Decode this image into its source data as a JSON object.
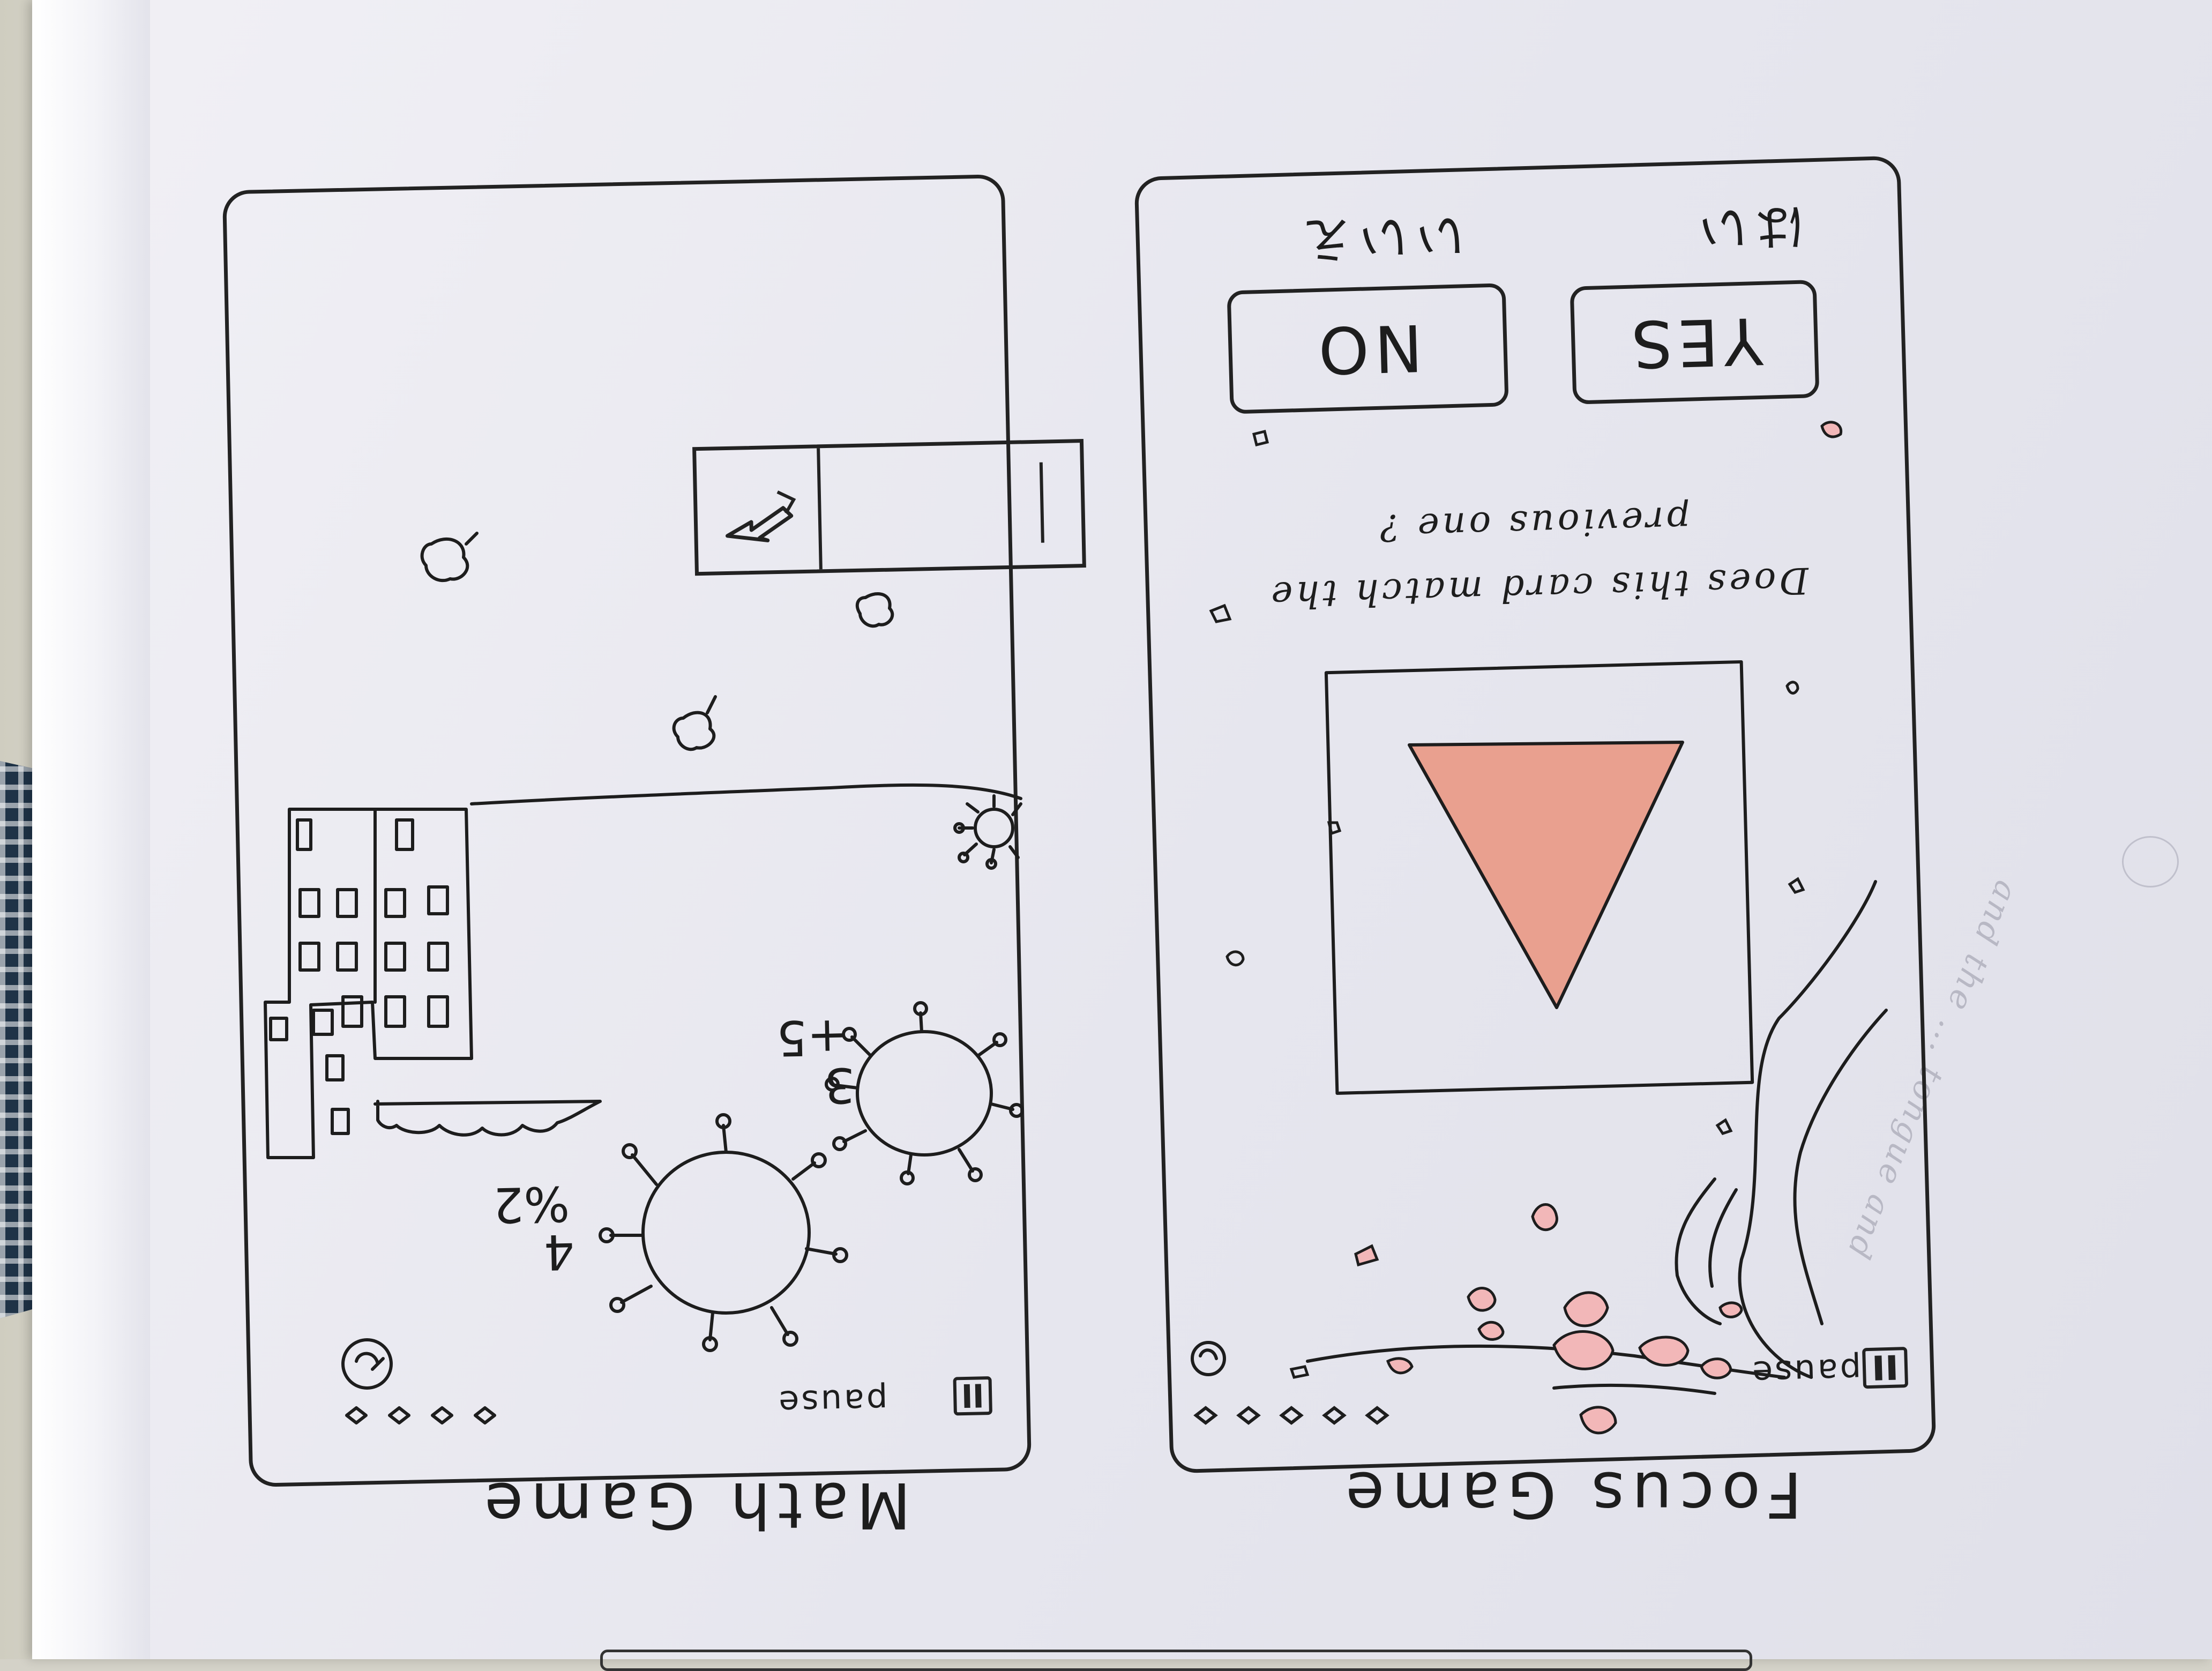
{
  "sketch": {
    "math_game": {
      "title": "Math Game",
      "pause_label": "pause",
      "virus_large_expression": [
        "4",
        "%2"
      ],
      "virus_small_expression": [
        "3",
        "+5"
      ],
      "lives_count": 4
    },
    "focus_game": {
      "title": "Focus Game",
      "pause_label": "pause",
      "question": [
        "Does this card match the",
        "previous one ?"
      ],
      "yes_label": "YES",
      "no_label": "NO",
      "yes_japanese": "はい",
      "no_japanese": "いいえ",
      "lives_count": 5,
      "card_shape": "triangle",
      "card_color": "#e9a08f"
    },
    "ink_color": "#1d1d1d",
    "faint_background_text": "and the ... tongue and"
  }
}
